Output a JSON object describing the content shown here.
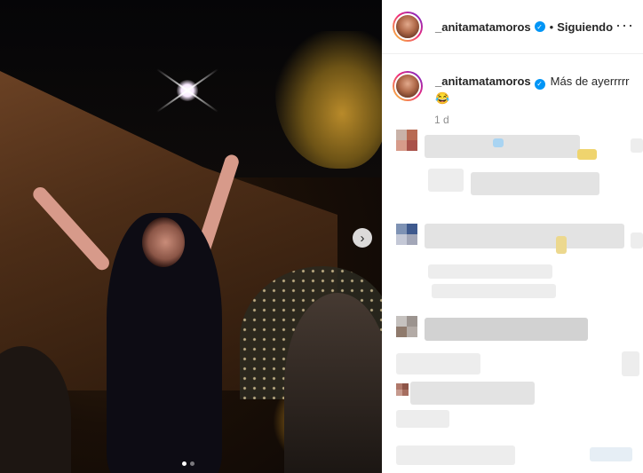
{
  "post": {
    "username": "_anitamatamoros",
    "verified_icon": "verified-badge-icon",
    "follow_status": "Siguiendo",
    "bullet": "•",
    "more_icon": "more-options-icon",
    "more_glyph": "···",
    "caption": "Más de ayerrrrr",
    "caption_emoji": "😂",
    "time_ago": "1 d"
  },
  "media": {
    "next_glyph": "›",
    "carousel_total": 2,
    "carousel_current": 1
  },
  "colors": {
    "accent": "#0095f6",
    "text": "#262626",
    "secondary": "#8e8e8e"
  }
}
